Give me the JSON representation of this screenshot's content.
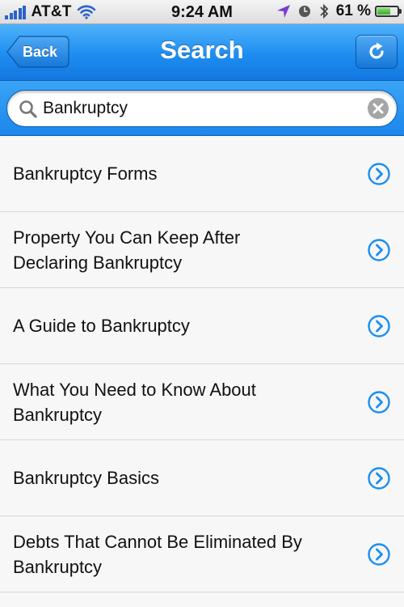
{
  "status_bar": {
    "carrier": "AT&T",
    "time": "9:24 AM",
    "battery_percent": "61 %",
    "battery_level": 0.61,
    "icons": [
      "signal-bars-icon",
      "wifi-icon",
      "location-arrow-icon",
      "alarm-clock-icon",
      "bluetooth-icon",
      "battery-icon"
    ]
  },
  "nav_bar": {
    "back_label": "Back",
    "title": "Search",
    "right_icon": "refresh-icon"
  },
  "search": {
    "value": "Bankruptcy",
    "placeholder": "",
    "icons": [
      "search-icon",
      "clear-icon"
    ]
  },
  "results": [
    {
      "label": "Bankruptcy Forms"
    },
    {
      "label": "Property You Can Keep After Declaring Bankruptcy"
    },
    {
      "label": "A Guide to Bankruptcy"
    },
    {
      "label": "What You Need to Know About Bankruptcy"
    },
    {
      "label": "Bankruptcy Basics"
    },
    {
      "label": "Debts That Cannot Be Eliminated By Bankruptcy"
    }
  ],
  "colors": {
    "nav_blue": "#1e8df0",
    "accent_blue": "#1a8ff0",
    "battery_green": "#3aa82c"
  }
}
